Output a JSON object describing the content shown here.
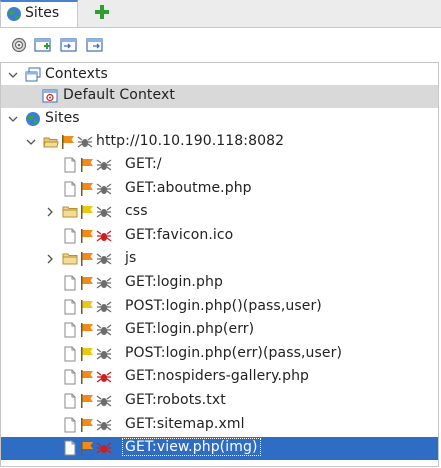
{
  "tab": {
    "label": "Sites"
  },
  "toolbar": {
    "icons": [
      "target-icon",
      "add-context-icon",
      "import-context-icon",
      "export-context-icon"
    ]
  },
  "tree": {
    "contexts_label": "Contexts",
    "default_context_label": "Default Context",
    "sites_label": "Sites",
    "host_label": "http://10.10.190.118:8082",
    "nodes": [
      {
        "label": "GET:/",
        "kind": "file",
        "flag": "orange",
        "spider": "gray"
      },
      {
        "label": "GET:aboutme.php",
        "kind": "file",
        "flag": "orange",
        "spider": "gray"
      },
      {
        "label": "css",
        "kind": "folder",
        "flag": "yellow",
        "spider": "gray"
      },
      {
        "label": "GET:favicon.ico",
        "kind": "file",
        "flag": "orange",
        "spider": "red"
      },
      {
        "label": "js",
        "kind": "folder",
        "flag": "orange",
        "spider": "gray"
      },
      {
        "label": "GET:login.php",
        "kind": "file",
        "flag": "orange",
        "spider": "gray"
      },
      {
        "label": "POST:login.php()(pass,user)",
        "kind": "file",
        "flag": "yellow",
        "spider": "gray"
      },
      {
        "label": "GET:login.php(err)",
        "kind": "file",
        "flag": "orange",
        "spider": "gray"
      },
      {
        "label": "POST:login.php(err)(pass,user)",
        "kind": "file",
        "flag": "yellow",
        "spider": "gray"
      },
      {
        "label": "GET:nospiders-gallery.php",
        "kind": "file",
        "flag": "orange",
        "spider": "red"
      },
      {
        "label": "GET:robots.txt",
        "kind": "file",
        "flag": "orange",
        "spider": "gray"
      },
      {
        "label": "GET:sitemap.xml",
        "kind": "file",
        "flag": "orange",
        "spider": "gray"
      },
      {
        "label": "GET:view.php(img)",
        "kind": "file",
        "flag": "orange",
        "spider": "red",
        "selected": true
      }
    ]
  },
  "colors": {
    "selection": "#2f6cc4",
    "context_selection": "#d9d9d9",
    "flag_orange": "#f28a1a",
    "flag_yellow": "#e8c818",
    "spider_red": "#cc1f1f",
    "spider_gray": "#6d6d6d"
  }
}
